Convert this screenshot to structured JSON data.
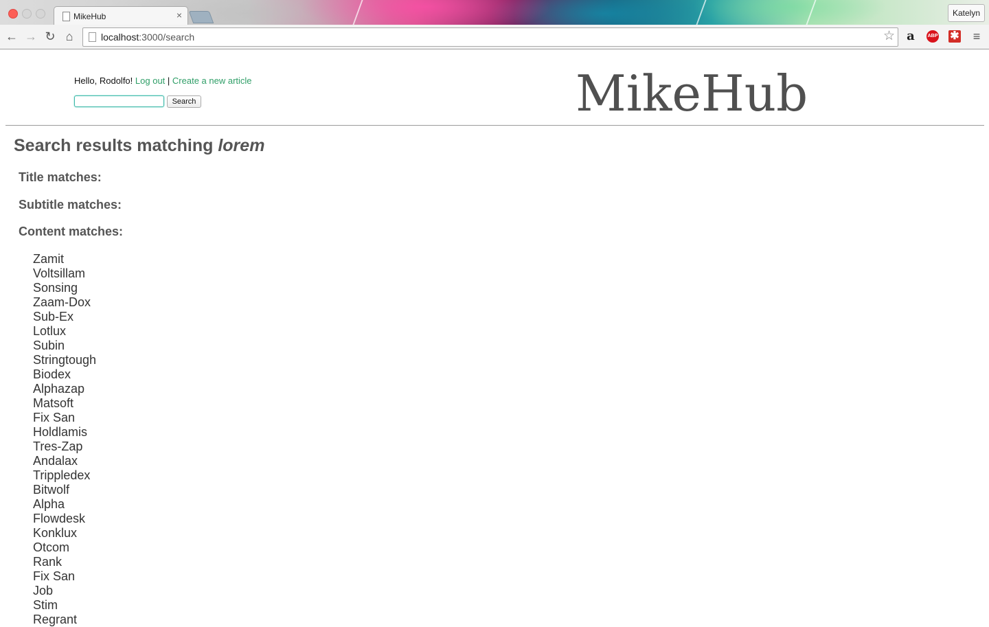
{
  "browser": {
    "tab_title": "MikeHub",
    "profile_name": "Katelyn",
    "url_host": "localhost",
    "url_path": ":3000/search",
    "icons": [
      "back-icon",
      "forward-icon",
      "reload-icon",
      "home-icon",
      "bookmark-star-icon",
      "amazon-icon",
      "adblock-icon",
      "lastpass-icon",
      "menu-icon"
    ]
  },
  "header": {
    "greeting": "Hello, Rodolfo!",
    "logout_label": "Log out",
    "separator": "|",
    "create_label": "Create a new article",
    "search_value": "",
    "search_button": "Search",
    "brand": "MikeHub"
  },
  "results": {
    "heading_prefix": "Search results matching",
    "query": "lorem",
    "title_heading": "Title matches:",
    "subtitle_heading": "Subtitle matches:",
    "content_heading": "Content matches:",
    "content_items": [
      "Zamit",
      "Voltsillam",
      "Sonsing",
      "Zaam-Dox",
      "Sub-Ex",
      "Lotlux",
      "Subin",
      "Stringtough",
      "Biodex",
      "Alphazap",
      "Matsoft",
      "Fix San",
      "Holdlamis",
      "Tres-Zap",
      "Andalax",
      "Trippledex",
      "Bitwolf",
      "Alpha",
      "Flowdesk",
      "Konklux",
      "Otcom",
      "Rank",
      "Fix San",
      "Job",
      "Stim",
      "Regrant"
    ]
  },
  "colors": {
    "link": "#2f9e67",
    "heading": "#555555",
    "brand": "#505050"
  }
}
